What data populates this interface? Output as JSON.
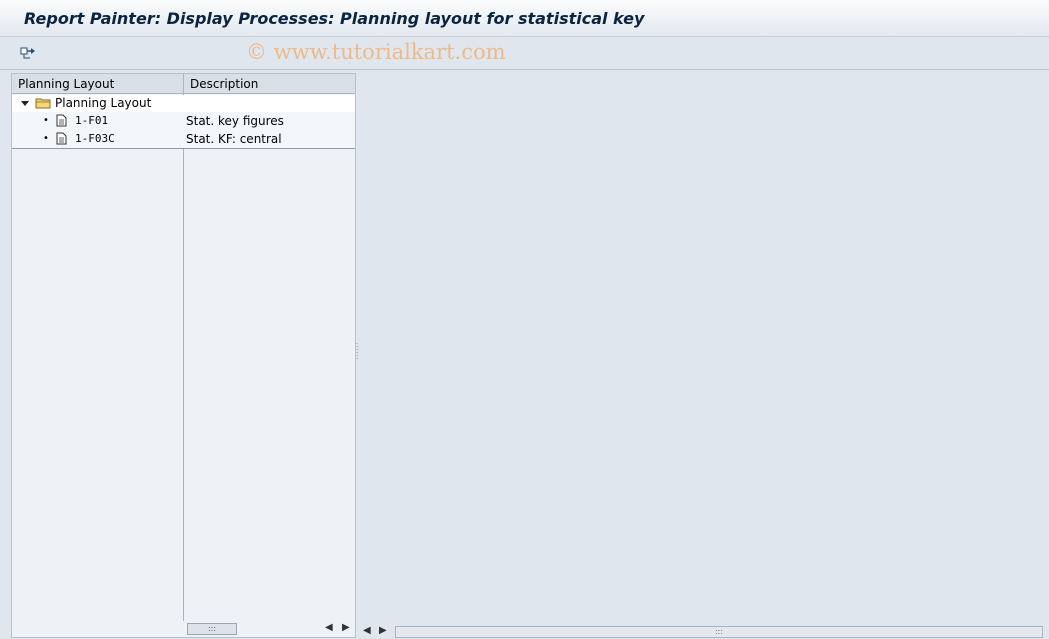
{
  "window": {
    "title": "Report Painter: Display Processes: Planning layout for statistical key"
  },
  "toolbar": {
    "watermark": "© www.tutorialkart.com",
    "other_object_icon": "switch-object-icon"
  },
  "tree": {
    "columns": [
      "Planning Layout",
      "Description"
    ],
    "root": {
      "label": "Planning Layout",
      "expanded": true,
      "icon": "folder-icon"
    },
    "items": [
      {
        "code": "1-F01",
        "description": "Stat. key figures",
        "icon": "document-icon"
      },
      {
        "code": "1-F03C",
        "description": "Stat. KF: central",
        "icon": "document-icon"
      }
    ]
  },
  "scroll": {
    "grip": ":::",
    "left_arrow": "◀",
    "right_arrow": "▶"
  },
  "colors": {
    "background": "#dfe6ee",
    "title_text": "#0b2540",
    "watermark": "#f0b98a"
  }
}
